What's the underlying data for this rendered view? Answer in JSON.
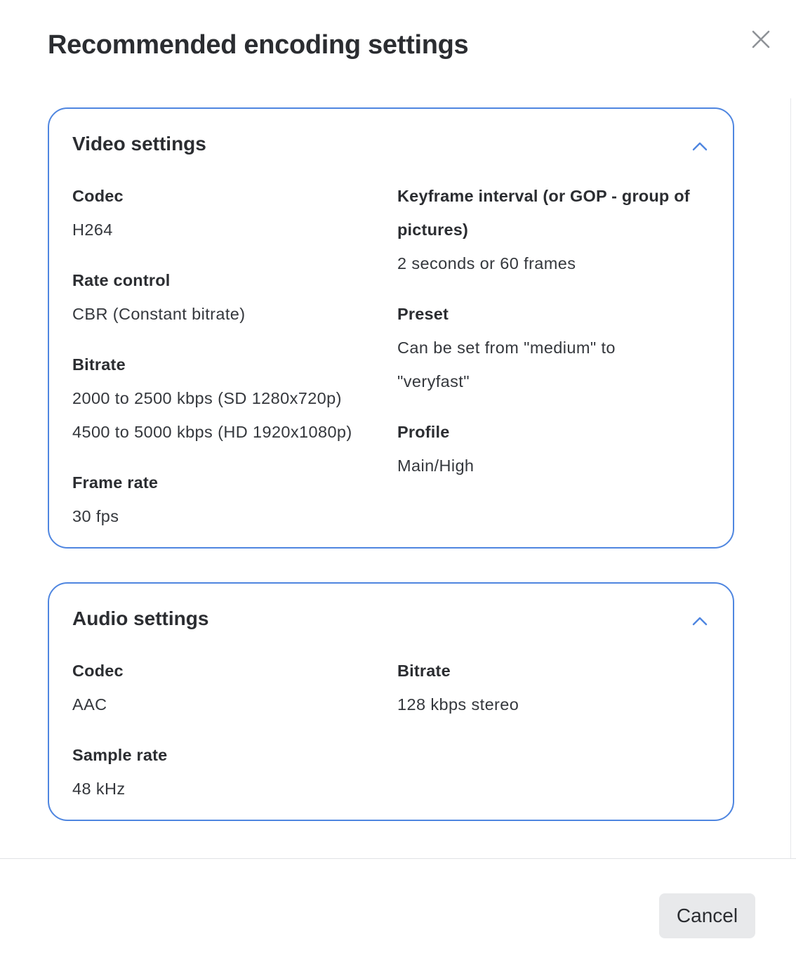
{
  "modal": {
    "title": "Recommended encoding settings",
    "close_icon": "close-icon",
    "cancel_label": "Cancel"
  },
  "colors": {
    "accent": "#4f86e0",
    "text": "#2b2d31",
    "button_bg": "#e8e9eb"
  },
  "video": {
    "title": "Video settings",
    "collapse_icon": "chevron-up-icon",
    "codec": {
      "label": "Codec",
      "value": "H264"
    },
    "rate_control": {
      "label": "Rate control",
      "value": "CBR (Constant bitrate)"
    },
    "bitrate": {
      "label": "Bitrate",
      "values": [
        "2000 to 2500 kbps (SD 1280x720p)",
        "4500 to 5000 kbps (HD 1920x1080p)"
      ]
    },
    "frame_rate": {
      "label": "Frame rate",
      "value": "30 fps"
    },
    "keyframe": {
      "label": "Keyframe interval (or GOP - group of pictures)",
      "value": "2 seconds or 60 frames"
    },
    "preset": {
      "label": "Preset",
      "value": "Can be set from \"medium\" to \"veryfast\""
    },
    "profile": {
      "label": "Profile",
      "value": "Main/High"
    }
  },
  "audio": {
    "title": "Audio settings",
    "collapse_icon": "chevron-up-icon",
    "codec": {
      "label": "Codec",
      "value": "AAC"
    },
    "sample_rate": {
      "label": "Sample rate",
      "value": "48 kHz"
    },
    "bitrate": {
      "label": "Bitrate",
      "value": "128 kbps stereo"
    }
  }
}
